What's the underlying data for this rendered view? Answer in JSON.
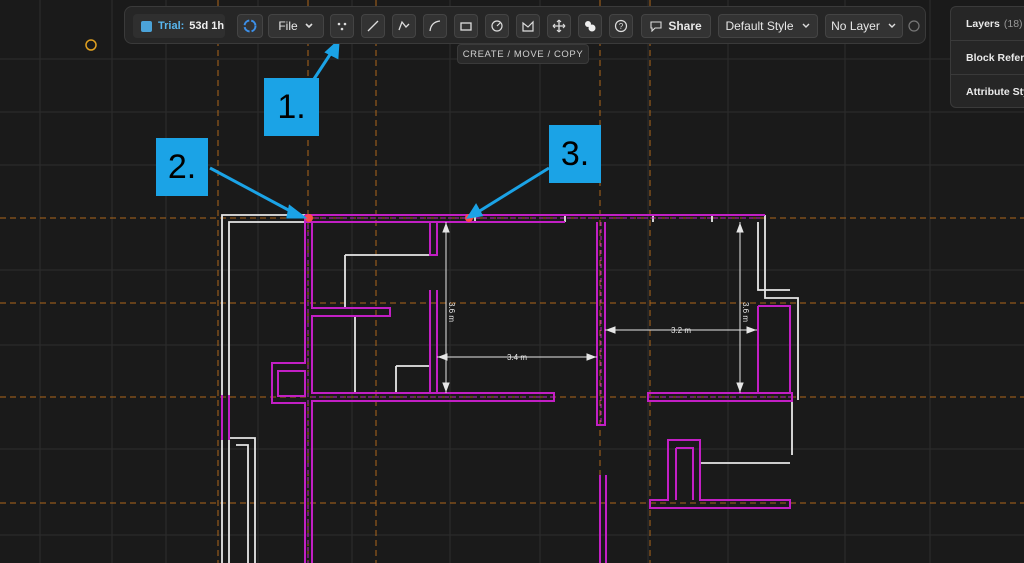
{
  "toolbar": {
    "trial_label": "Trial:",
    "trial_time": "53d 1h",
    "file_label": "File",
    "share_label": "Share",
    "style_label": "Default Style",
    "layer_label": "No Layer",
    "tooltip": "CREATE / MOVE / COPY"
  },
  "panel": {
    "layers_label": "Layers",
    "layers_count": "(18)",
    "block_ref_label": "Block Refere",
    "attribute_label": "Attribute Sty"
  },
  "dimensions": {
    "d1": "3.6 m",
    "d2": "3.4 m",
    "d3": "3.2 m",
    "d4": "3.6 m"
  },
  "callouts": {
    "c1": "1.",
    "c2": "2.",
    "c3": "3."
  },
  "colors": {
    "background": "#1a1a1a",
    "wall_highlight": "#c21fc4",
    "wall": "#e6e6e6",
    "guide": "#c8741a",
    "callout": "#1ba3e6",
    "point": "#ff4a4a"
  },
  "icons": [
    "cube-icon",
    "rotate-icon",
    "chevron-down-icon",
    "point-icon",
    "line-icon",
    "polyline-icon",
    "arc-icon",
    "rectangle-icon",
    "gauge-icon",
    "hatch-icon",
    "move-icon",
    "block-icon",
    "help-icon",
    "comment-icon",
    "circle-status-icon"
  ]
}
